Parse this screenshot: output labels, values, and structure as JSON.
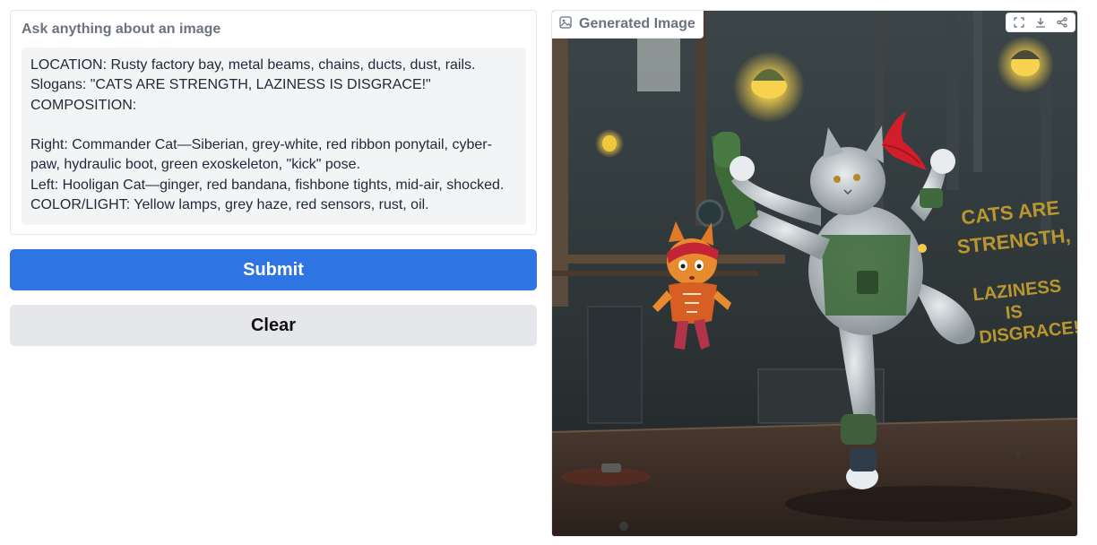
{
  "prompt": {
    "label": "Ask anything about an image",
    "text": "LOCATION: Rusty factory bay, metal beams, chains, ducts, dust, rails.\nSlogans: \"CATS ARE STRENGTH, LAZINESS IS DISGRACE!\"\nCOMPOSITION:\n\nRight: Commander Cat—Siberian, grey-white, red ribbon ponytail, cyber-paw, hydraulic boot, green exoskeleton, \"kick\" pose.\nLeft: Hooligan Cat—ginger, red bandana, fishbone tights, mid-air, shocked.\nCOLOR/LIGHT: Yellow lamps, grey haze, red sensors, rust, oil."
  },
  "buttons": {
    "submit": "Submit",
    "clear": "Clear"
  },
  "output": {
    "label": "Generated Image",
    "wall_text_1": "CATS ARE",
    "wall_text_2": "STRENGTH,",
    "wall_text_3": "LAZINESS",
    "wall_text_4": "IS",
    "wall_text_5": "DISGRACE!",
    "icons": [
      "image-icon",
      "fullscreen-icon",
      "download-icon",
      "share-icon"
    ]
  },
  "colors": {
    "submit_bg": "#2f74e3",
    "clear_bg": "#e5e7eb",
    "label_gray": "#6b7280"
  }
}
